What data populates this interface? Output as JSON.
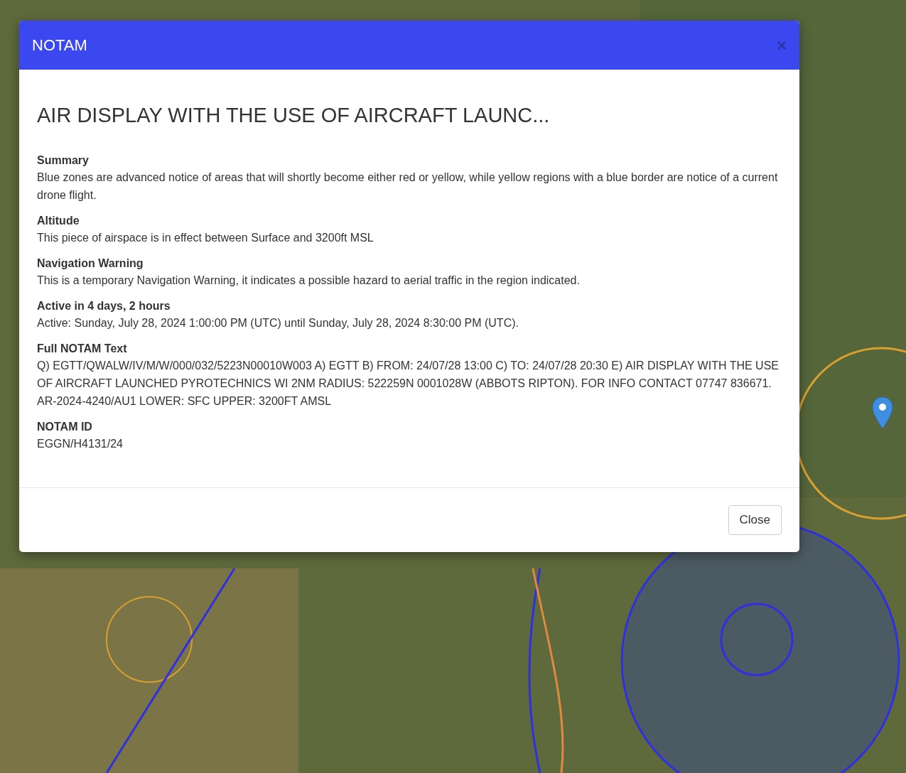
{
  "modal": {
    "title": "NOTAM",
    "close_icon": "×",
    "heading": "AIR DISPLAY WITH THE USE OF AIRCRAFT LAUNC...",
    "sections": [
      {
        "label": "Summary",
        "text": "Blue zones are advanced notice of areas that will shortly become either red or yellow, while yellow regions with a blue border are notice of a current drone flight."
      },
      {
        "label": "Altitude",
        "text": "This piece of airspace is in effect between Surface and 3200ft MSL"
      },
      {
        "label": "Navigation Warning",
        "text": "This is a temporary Navigation Warning, it indicates a possible hazard to aerial traffic in the region indicated."
      },
      {
        "label": "Active in 4 days, 2 hours",
        "text": "Active: Sunday, July 28, 2024 1:00:00 PM (UTC) until Sunday, July 28, 2024 8:30:00 PM (UTC)."
      },
      {
        "label": "Full NOTAM Text",
        "text": "Q) EGTT/QWALW/IV/M/W/000/032/5223N00010W003 A) EGTT B) FROM: 24/07/28 13:00 C) TO: 24/07/28 20:30 E) AIR DISPLAY WITH THE USE OF AIRCRAFT LAUNCHED PYROTECHNICS WI 2NM RADIUS: 522259N 0001028W (ABBOTS RIPTON). FOR INFO CONTACT 07747 836671. AR-2024-4240/AU1 LOWER: SFC UPPER: 3200FT AMSL"
      },
      {
        "label": "NOTAM ID",
        "text": "EGGN/H4131/24"
      }
    ],
    "button": "Close"
  }
}
